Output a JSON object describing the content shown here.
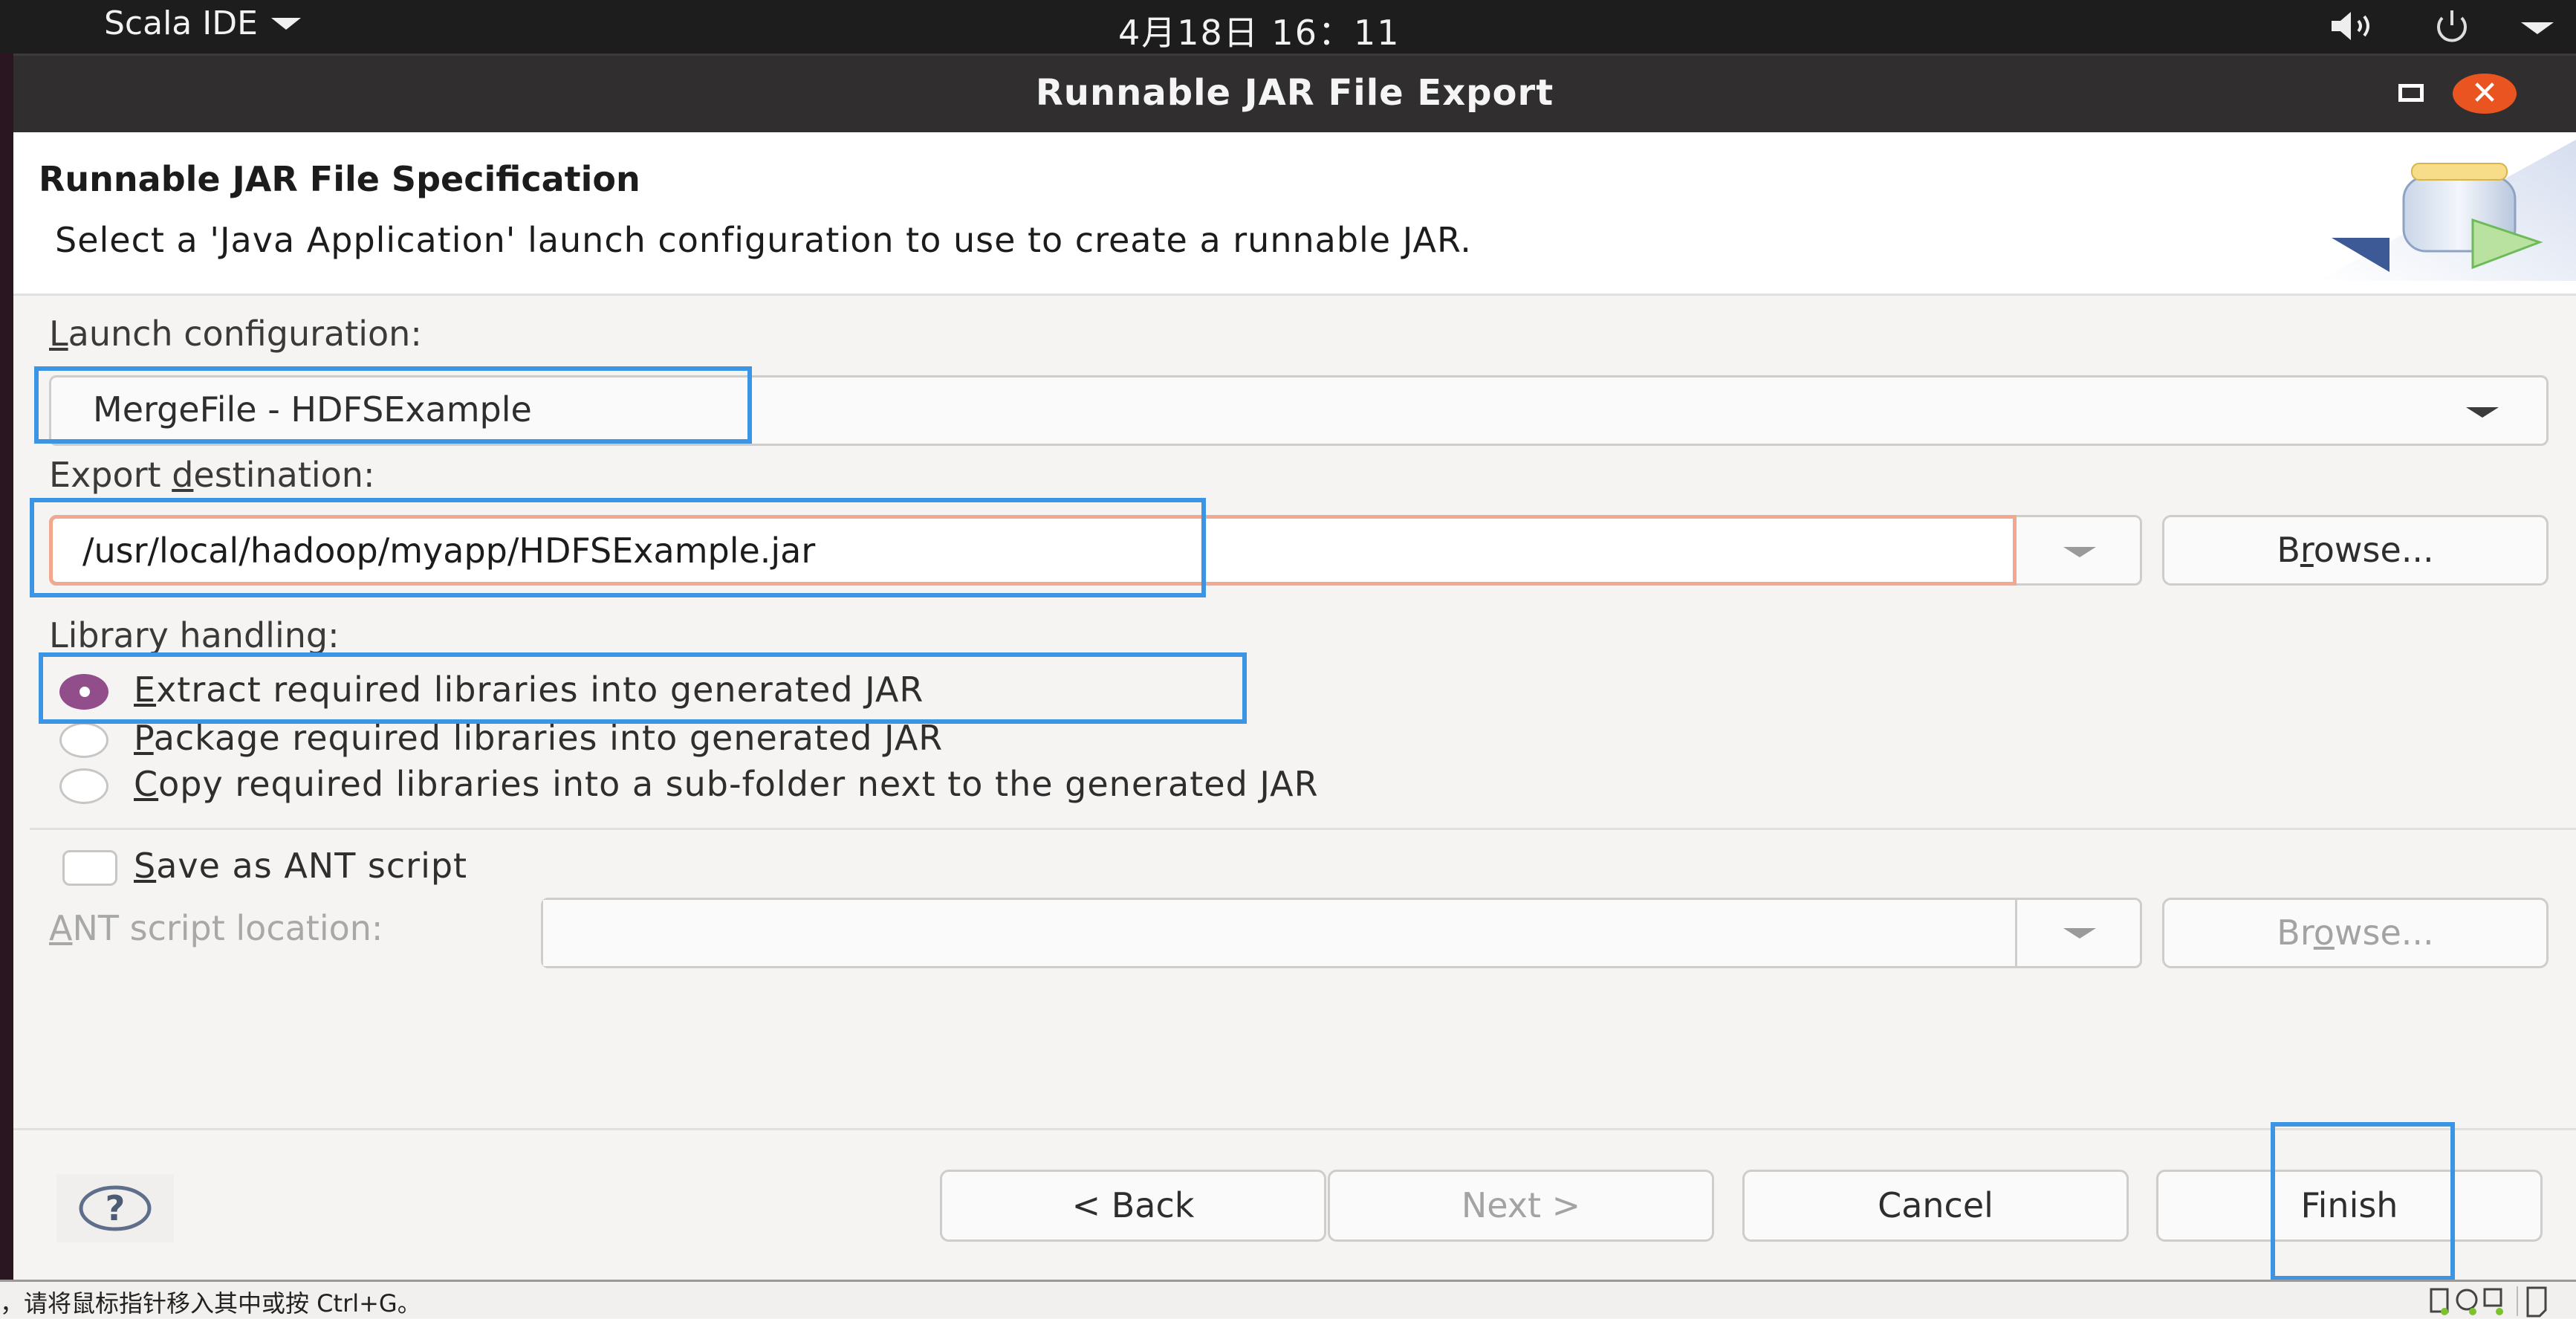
{
  "topbar": {
    "app_menu": "Scala IDE",
    "clock": "4月18日  16：11",
    "icons": [
      "volume-icon",
      "power-icon",
      "system-menu-arrow-icon"
    ]
  },
  "window": {
    "title": "Runnable JAR File Export",
    "maximize_icon": "maximize-icon",
    "close_icon": "close-icon",
    "close_glyph": "✕"
  },
  "header": {
    "title": "Runnable JAR File Specification",
    "description": "Select a 'Java Application' launch configuration to use to create a runnable JAR.",
    "banner_icon": "jar-export-icon"
  },
  "form": {
    "launch_config": {
      "label_mnemonic": "L",
      "label_rest": "aunch configuration:",
      "value": "MergeFile - HDFSExample"
    },
    "export_destination": {
      "label_pre": "Export ",
      "label_mnemonic": "d",
      "label_rest": "estination:",
      "value": "/usr/local/hadoop/myapp/HDFSExample.jar",
      "browse_pre": "B",
      "browse_mnemonic": "r",
      "browse_rest": "owse..."
    },
    "library_handling": {
      "label": "Library handling:",
      "options": [
        {
          "mnemonic": "E",
          "rest": "xtract required libraries into generated JAR",
          "checked": true
        },
        {
          "mnemonic": "P",
          "rest": "ackage required libraries into generated JAR",
          "checked": false
        },
        {
          "mnemonic": "C",
          "rest": "opy required libraries into a sub-folder next to the generated JAR",
          "checked": false
        }
      ]
    },
    "save_ant": {
      "mnemonic": "S",
      "rest": "ave as ANT script",
      "checked": false
    },
    "ant_location": {
      "label_mnemonic": "A",
      "label_rest": "NT script location:",
      "value": "",
      "browse_pre": "Br",
      "browse_mnemonic": "o",
      "browse_rest": "wse..."
    }
  },
  "footer": {
    "help_glyph": "?",
    "back": "< Back",
    "next": "Next >",
    "cancel": "Cancel",
    "finish": "Finish"
  },
  "statusbar": {
    "text": "，请将鼠标指针移入其中或按 Ctrl+G。"
  },
  "colors": {
    "accent_highlight": "#3b95e4",
    "error_border": "#f2a78f",
    "radio_checked": "#924d8b",
    "close_button": "#e95420"
  }
}
